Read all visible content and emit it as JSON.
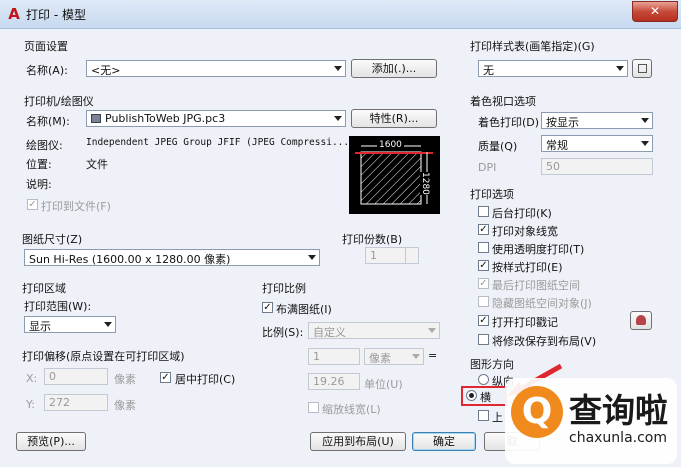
{
  "window": {
    "title": "打印 - 模型",
    "close_glyph": "✕",
    "app_glyph": "A"
  },
  "page_setup": {
    "group": "页面设置",
    "name_label": "名称(A):",
    "name_value": "<无>",
    "add_button": "添加(.)..."
  },
  "printer": {
    "group": "打印机/绘图仪",
    "name_label": "名称(M):",
    "name_value": "PublishToWeb JPG.pc3",
    "props_button": "特性(R)...",
    "plotter_label": "绘图仪:",
    "plotter_value": "Independent JPEG Group JFIF (JPEG Compressi...",
    "location_label": "位置:",
    "location_value": "文件",
    "desc_label": "说明:",
    "print_to_file": "打印到文件(F)"
  },
  "preview": {
    "width_label": "1600",
    "height_label": "1280"
  },
  "paper_size": {
    "group": "图纸尺寸(Z)",
    "value": "Sun Hi-Res (1600.00 x 1280.00 像素)"
  },
  "copies": {
    "group": "打印份数(B)",
    "value": "1"
  },
  "plot_area": {
    "group": "打印区域",
    "range_label": "打印范围(W):",
    "range_value": "显示"
  },
  "plot_offset": {
    "group": "打印偏移(原点设置在可打印区域)",
    "x_label": "X:",
    "x_value": "0",
    "x_unit": "像素",
    "y_label": "Y:",
    "y_value": "272",
    "y_unit": "像素",
    "center_label": "居中打印(C)"
  },
  "plot_scale": {
    "group": "打印比例",
    "fit_label": "布满图纸(I)",
    "scale_label": "比例(S):",
    "scale_value": "自定义",
    "v1": "1",
    "unit": "像素",
    "eq": "=",
    "v2": "19.26",
    "unit2": "单位(U)",
    "lineweight_label": "缩放线宽(L)"
  },
  "style_table": {
    "group": "打印样式表(画笔指定)(G)",
    "value": "无"
  },
  "viewport": {
    "group": "着色视口选项",
    "shade_label": "着色打印(D)",
    "shade_value": "按显示",
    "quality_label": "质量(Q)",
    "quality_value": "常规",
    "dpi_label": "DPI",
    "dpi_value": "50"
  },
  "options": {
    "group": "打印选项",
    "items": [
      {
        "label": "后台打印(K)"
      },
      {
        "label": "打印对象线宽"
      },
      {
        "label": "使用透明度打印(T)"
      },
      {
        "label": "按样式打印(E)"
      },
      {
        "label": "最后打印图纸空间"
      },
      {
        "label": "隐藏图纸空间对象(J)"
      },
      {
        "label": "打开打印戳记"
      },
      {
        "label": "将修改保存到布局(V)"
      }
    ],
    "checked_glyph": "✓"
  },
  "orientation": {
    "group": "图形方向",
    "portrait": "纵向",
    "landscape": "横",
    "upside": "上"
  },
  "buttons": {
    "preview": "预览(P)...",
    "apply": "应用到布局(U)",
    "ok": "确定",
    "cancel": "取"
  },
  "watermark": {
    "glyph": "Q",
    "title": "查询啦",
    "url": "chaxunla.com"
  },
  "colors": {
    "accent": "#3c7fb1",
    "highlight": "#e0262e"
  }
}
